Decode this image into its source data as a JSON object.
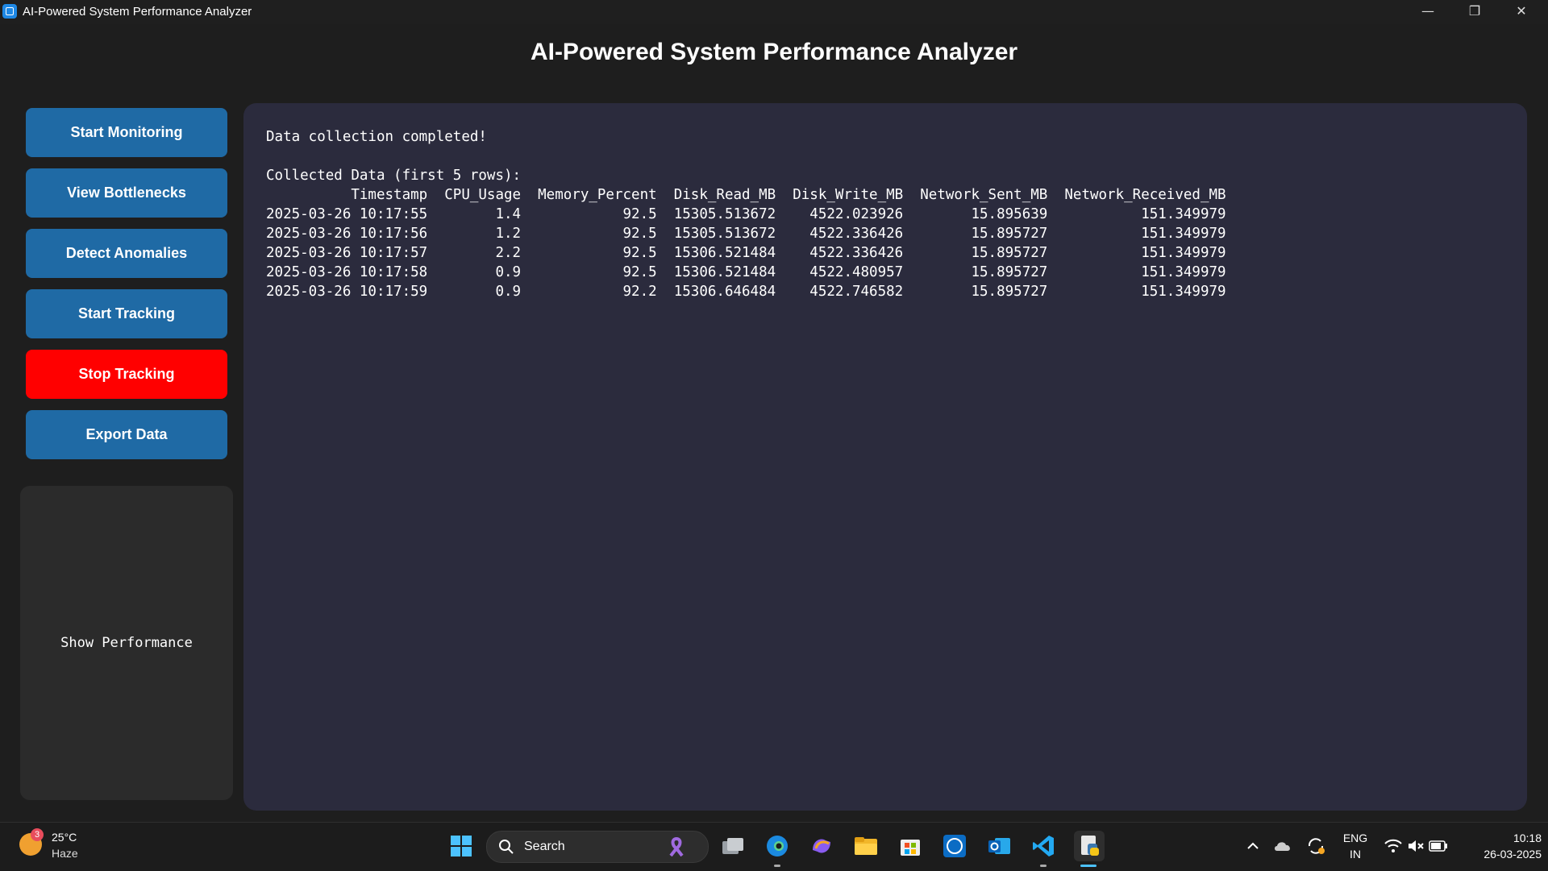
{
  "window": {
    "title": "AI-Powered System Performance Analyzer",
    "minimize_glyph": "—",
    "restore_glyph": "❐",
    "close_glyph": "✕"
  },
  "app": {
    "heading": "AI-Powered System Performance Analyzer",
    "sidebar": {
      "start_monitoring": "Start Monitoring",
      "view_bottlenecks": "View Bottlenecks",
      "detect_anomalies": "Detect Anomalies",
      "start_tracking": "Start Tracking",
      "stop_tracking": "Stop Tracking",
      "export_data": "Export Data"
    },
    "performance_panel": {
      "label": "Show Performance"
    },
    "output": {
      "status": "Data collection completed!",
      "table_caption": "Collected Data (first 5 rows):",
      "columns": [
        "Timestamp",
        "CPU_Usage",
        "Memory_Percent",
        "Disk_Read_MB",
        "Disk_Write_MB",
        "Network_Sent_MB",
        "Network_Received_MB"
      ],
      "rows": [
        [
          "2025-03-26 10:17:55",
          "1.4",
          "92.5",
          "15305.513672",
          "4522.023926",
          "15.895639",
          "151.349979"
        ],
        [
          "2025-03-26 10:17:56",
          "1.2",
          "92.5",
          "15305.513672",
          "4522.336426",
          "15.895727",
          "151.349979"
        ],
        [
          "2025-03-26 10:17:57",
          "2.2",
          "92.5",
          "15306.521484",
          "4522.336426",
          "15.895727",
          "151.349979"
        ],
        [
          "2025-03-26 10:17:58",
          "0.9",
          "92.5",
          "15306.521484",
          "4522.480957",
          "15.895727",
          "151.349979"
        ],
        [
          "2025-03-26 10:17:59",
          "0.9",
          "92.2",
          "15306.646484",
          "4522.746582",
          "15.895727",
          "151.349979"
        ]
      ]
    }
  },
  "colors": {
    "button_primary": "#1f6aa5",
    "button_danger": "#ff0000",
    "output_panel": "#2b2b3d",
    "window_bg": "#1e1e1e"
  },
  "taskbar": {
    "weather": {
      "badge": "3",
      "temperature": "25°C",
      "condition": "Haze"
    },
    "search_label": "Search",
    "pinned_icons": [
      "windows-start-icon",
      "task-view-icon",
      "edge-icon",
      "copilot-icon",
      "file-explorer-icon",
      "store-icon",
      "dell-icon",
      "outlook-icon",
      "vscode-icon",
      "python-icon"
    ],
    "tray": {
      "language": "ENG",
      "region": "IN",
      "time": "10:18",
      "date": "26-03-2025"
    }
  }
}
